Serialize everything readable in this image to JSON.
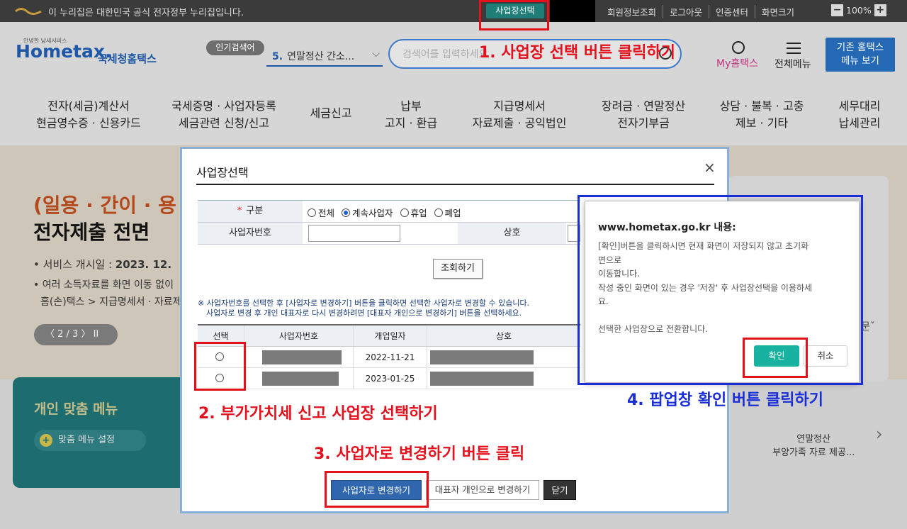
{
  "gov_bar": {
    "notice": "이 누리집은 대한민국 공식 전자정부 누리집입니다.",
    "select_business_label": "사업장선택",
    "links": [
      "회원정보조회",
      "로그아웃",
      "인증센터",
      "화면크기"
    ],
    "zoom_minus": "−",
    "zoom_value": "100%",
    "zoom_plus": "+"
  },
  "header": {
    "logo_sub": "안녕한 납세서비스",
    "logo_main": "Hometax.",
    "logo_kr": "국세청홈택스",
    "popular_label": "인기검색어",
    "popular_num": "5.",
    "popular_text": "연말정산 간소...",
    "search_placeholder": "검색어를 입력하세요",
    "my_label": "My홈택스",
    "menu_label": "전체메뉴",
    "legacy_line1": "기존 홈택스",
    "legacy_line2": "메뉴 보기",
    "gnb": [
      {
        "l1": "전자(세금)계산서",
        "l2": "현금영수증 · 신용카드"
      },
      {
        "l1": "국세증명 · 사업자등록",
        "l2": "세금관련 신청/신고"
      },
      {
        "l1": "세금신고",
        "l2": ""
      },
      {
        "l1": "납부",
        "l2": "고지 · 환급"
      },
      {
        "l1": "지급명세서",
        "l2": "자료제출 · 공익법인"
      },
      {
        "l1": "장려금 · 연말정산",
        "l2": "전자기부금"
      },
      {
        "l1": "상담 · 불복 · 고충",
        "l2": "제보 · 기타"
      },
      {
        "l1": "세무대리",
        "l2": "납세관리"
      }
    ]
  },
  "banner": {
    "line1": "(일용 · 간이 · 용",
    "line2": "전자제출 전면 ",
    "service_label": "• 서비스 개시일 : ",
    "service_date": "2023. 12. ",
    "desc1": "• 여러 소득자료를 화면 이동 없이",
    "desc2": "홈(손)택스 > 지급명세서 · 자료제",
    "pager": "〈  2 / 3  〉   II"
  },
  "personal_menu": {
    "title": "개인 맞춤 메뉴",
    "setting": "맞춤 메뉴 설정",
    "plus": "+"
  },
  "right_card": {
    "line1": "연말정산",
    "line2": "부양가족 자료 제공...",
    "chev": "›",
    "chev_small": "문ˇ"
  },
  "modal": {
    "title": "사업장선택",
    "close": "×",
    "form": {
      "type_label": "구분",
      "required_mark": "*",
      "radios": [
        {
          "label": "전체",
          "checked": false
        },
        {
          "label": "계속사업자",
          "checked": true
        },
        {
          "label": "휴업",
          "checked": false
        },
        {
          "label": "폐업",
          "checked": false
        }
      ],
      "bizno_label": "사업자번호",
      "name_label": "상호"
    },
    "search_button": "조회하기",
    "notice1": "※ 사업자번호를 선택한 후 [사업자로 변경하기] 버튼을 클릭하면 선택한 사업자로 변경할 수 있습니다.",
    "notice2": "사업자로 변경 후 개인 대표자로 다시 변경하려면 [대표자 개인으로 변경하기] 버튼을 선택하세요.",
    "table": {
      "headers": [
        "선택",
        "사업자번호",
        "개업일자",
        "상호"
      ],
      "rows": [
        {
          "open_date": "2022-11-21"
        },
        {
          "open_date": "2023-01-25"
        }
      ]
    },
    "buttons": {
      "change_to_business": "사업자로 변경하기",
      "change_to_owner": "대표자 개인으로 변경하기",
      "close": "닫기"
    }
  },
  "alert": {
    "header": "www.hometax.go.kr 내용:",
    "body1": "[확인]버튼을 클릭하시면 현재 화면이 저장되지 않고 초기화",
    "body2": "면으로",
    "body3": "이동합니다.",
    "body4": "작성 중인 화면이 있는 경우 '저장' 후 사업장선택을 이용하세",
    "body5": "요.",
    "body6": "선택한 사업장으로 전환합니다.",
    "ok": "확인",
    "cancel": "취소"
  },
  "annotations": {
    "step1": "1. 사업장 선택 버튼 클릭하기",
    "step2": "2. 부가가치세 신고 사업장 선택하기",
    "step3": "3. 사업자로 변경하기 버튼 클릭",
    "step4": "4. 팝업창 확인 버튼 클릭하기",
    "red_color": "#e4101c",
    "blue_color": "#1a2ed8"
  }
}
